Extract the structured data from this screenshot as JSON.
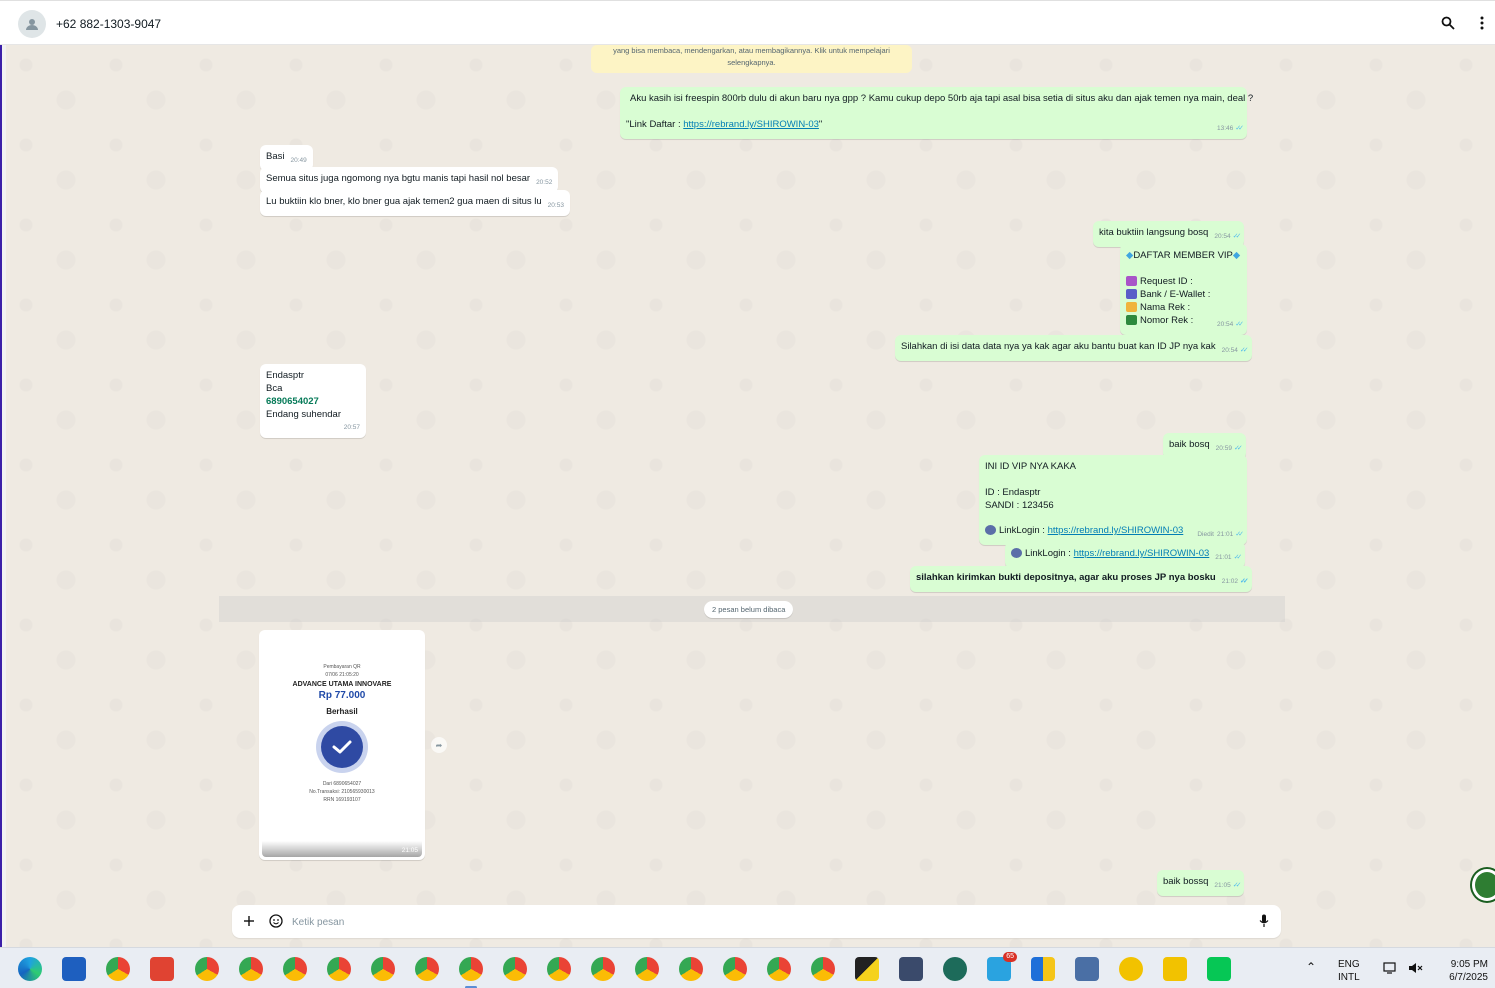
{
  "header": {
    "contact_name": "+62 882-1303-9047",
    "icons": [
      "person-icon",
      "search-icon",
      "kebab-menu-icon"
    ]
  },
  "system_notice": {
    "line1": "yang bisa membaca, mendengarkan, atau membagikannya. Klik untuk mempelajari",
    "line2": "selengkapnya."
  },
  "messages": {
    "m1": {
      "text1": "Aku kasih isi freespin 800rb dulu di akun baru nya gpp ? Kamu cukup depo 50rb aja tapi asal bisa setia di situs aku dan ajak temen nya main, deal ?",
      "prefix": "\"Link Daftar : ",
      "link": "https://rebrand.ly/SHIROWIN-03",
      "suffix": "\"",
      "time": "13:46"
    },
    "m2": {
      "text": "Basi",
      "time": "20:49"
    },
    "m3": {
      "text": "Semua situs juga ngomong nya bgtu manis tapi hasil nol besar",
      "time": "20:52"
    },
    "m4": {
      "text": "Lu buktiin klo bner, klo bner gua ajak temen2 gua maen di situs lu",
      "time": "20:53"
    },
    "m5": {
      "text": "kita buktiin langsung bosq",
      "time": "20:54"
    },
    "m6": {
      "title": "DAFTAR MEMBER VIP",
      "line1": "Request ID :",
      "line2": "Bank / E-Wallet :",
      "line3": "Nama Rek :",
      "line4": "Nomor Rek :",
      "time": "20:54"
    },
    "m7": {
      "text": "Silahkan di isi data data nya ya kak agar aku bantu buat kan ID JP nya kak",
      "time": "20:54"
    },
    "m8": {
      "line1": "Endasptr",
      "line2": "Bca",
      "line3": "6890654027",
      "line4": "Endang suhendar",
      "time": "20:57"
    },
    "m9": {
      "text": "baik bosq",
      "time": "20:59"
    },
    "m10": {
      "line1": "INI ID VIP NYA KAKA",
      "line2": "ID     :  Endasptr",
      "line3": "SANDI : 123456",
      "prefix": "LinkLogin :  ",
      "link": "https://rebrand.ly/SHIROWIN-03",
      "edited": "Diedit",
      "time": "21:01"
    },
    "m11": {
      "prefix": "LinkLogin :  ",
      "link": "https://rebrand.ly/SHIROWIN-03",
      "time": "21:01"
    },
    "m12": {
      "text": "silahkan kirimkan bukti depositnya, agar aku proses JP nya bosku",
      "time": "21:02"
    },
    "m13": {
      "text": "baik bossq",
      "time": "21:05"
    }
  },
  "unread_divider": "2 pesan belum dibaca",
  "receipt": {
    "label": "Pembayaran QR",
    "datetime": "07/06 21:05:20",
    "merchant": "ADVANCE UTAMA INNOVARE",
    "amount": "Rp 77.000",
    "status": "Berhasil",
    "from": "Dari 6890654027",
    "trx": "No.Transaksi: 210565930013",
    "rrn": "RRN 169193107",
    "time": "21:05"
  },
  "composer": {
    "placeholder": "Ketik pesan"
  },
  "taskbar": {
    "lang1": "ENG",
    "lang2": "INTL",
    "clock": "9:05 PM",
    "date": "6/7/2025",
    "telegram_badge": "65"
  }
}
